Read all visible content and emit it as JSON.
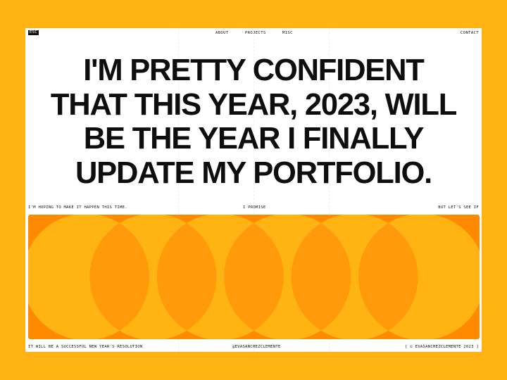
{
  "nav": {
    "badge": "ESC",
    "links": [
      "ABOUT",
      "PROJECTS",
      "MISC"
    ],
    "contact": "CONTACT"
  },
  "headline": {
    "lines": [
      "I'M PRETTY CONFIDENT",
      "THAT THIS YEAR, 2023, WILL",
      "BE THE YEAR I FINALLY",
      "UPDATE MY PORTFOLIO."
    ]
  },
  "captions_top": {
    "left": "I'M HOPING TO MAKE IT HAPPEN THIS TIME.",
    "center": "I PROMISE",
    "right": "BUT LET'S SEE IF"
  },
  "captions_bottom": {
    "left": "IT WILL BE A SUCCESSFUL NEW YEAR'S RESOLUTION",
    "center": "@EVASANCHEZCLEMENTE",
    "right": "[ © EVASANCHEZCLEMENTE 2023 ]"
  },
  "colors": {
    "background": "#FFB413",
    "page": "#FFFFFF",
    "banner": "#FF8A00",
    "circle": "#FFB413",
    "overlap": "#FF9A0A",
    "text": "#0E0E0E"
  },
  "banner": {
    "circle_count": 6
  }
}
